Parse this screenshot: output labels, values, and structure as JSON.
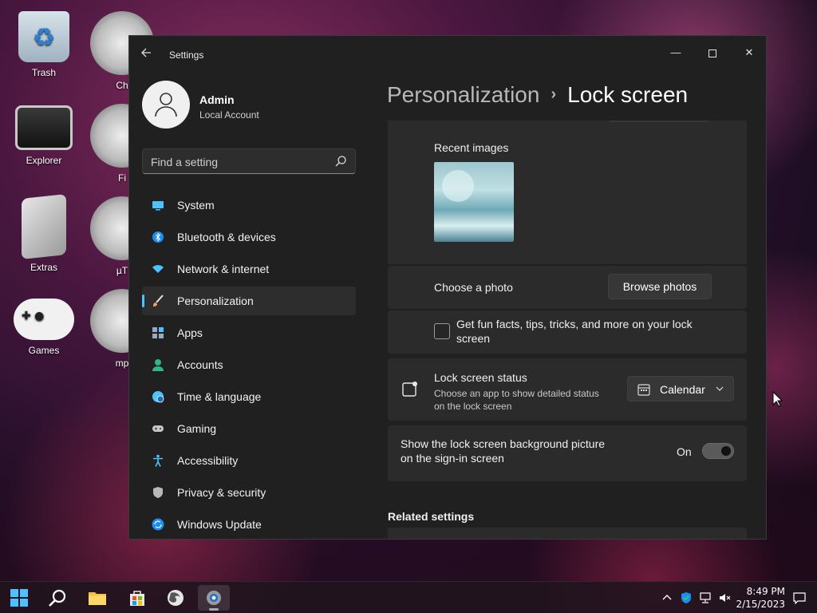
{
  "desktop": {
    "icons": [
      {
        "label": "Trash"
      },
      {
        "label": "Explorer"
      },
      {
        "label": "Extras"
      },
      {
        "label": "Games"
      },
      {
        "label": "Ch"
      },
      {
        "label": "Fi"
      },
      {
        "label": "µT"
      },
      {
        "label": "mp"
      }
    ]
  },
  "window": {
    "title": "Settings",
    "min_label": "—",
    "close_label": "✕"
  },
  "profile": {
    "name": "Admin",
    "account_type": "Local Account"
  },
  "search": {
    "placeholder": "Find a setting"
  },
  "nav": {
    "items": [
      {
        "label": "System",
        "icon": "system-icon",
        "color": "#4cc2ff"
      },
      {
        "label": "Bluetooth & devices",
        "icon": "bluetooth-icon",
        "color": "#1b8ff0"
      },
      {
        "label": "Network & internet",
        "icon": "wifi-icon",
        "color": "#4cc2ff"
      },
      {
        "label": "Personalization",
        "icon": "brush-icon",
        "color": "#f0a060",
        "active": true
      },
      {
        "label": "Apps",
        "icon": "apps-icon",
        "color": "#9aa7c7"
      },
      {
        "label": "Accounts",
        "icon": "person-icon",
        "color": "#2fb58c"
      },
      {
        "label": "Time & language",
        "icon": "globe-clock-icon",
        "color": "#4cc2ff"
      },
      {
        "label": "Gaming",
        "icon": "gamepad-icon",
        "color": "#c8c8c8"
      },
      {
        "label": "Accessibility",
        "icon": "accessibility-icon",
        "color": "#4cc2ff"
      },
      {
        "label": "Privacy & security",
        "icon": "shield-icon",
        "color": "#b8b8b8"
      },
      {
        "label": "Windows Update",
        "icon": "update-icon",
        "color": "#1b8ff0"
      }
    ]
  },
  "breadcrumb": {
    "parent": "Personalization",
    "separator": "›",
    "current": "Lock screen"
  },
  "recent_images": {
    "label": "Recent images"
  },
  "choose_photo": {
    "label": "Choose a photo",
    "button": "Browse photos"
  },
  "fun_facts": {
    "label": "Get fun facts, tips, tricks, and more on your lock screen",
    "checked": false
  },
  "lock_status": {
    "label": "Lock screen status",
    "description": "Choose an app to show detailed status on the lock screen",
    "selected": "Calendar"
  },
  "signin_background": {
    "label": "Show the lock screen background picture on the sign-in screen",
    "state": "On"
  },
  "related": {
    "title": "Related settings"
  },
  "taskbar": {
    "time": "8:49 PM",
    "date": "2/15/2023"
  },
  "colors": {
    "accent": "#4cc2ff",
    "window_bg": "#202020",
    "card_bg": "#2b2b2b"
  }
}
